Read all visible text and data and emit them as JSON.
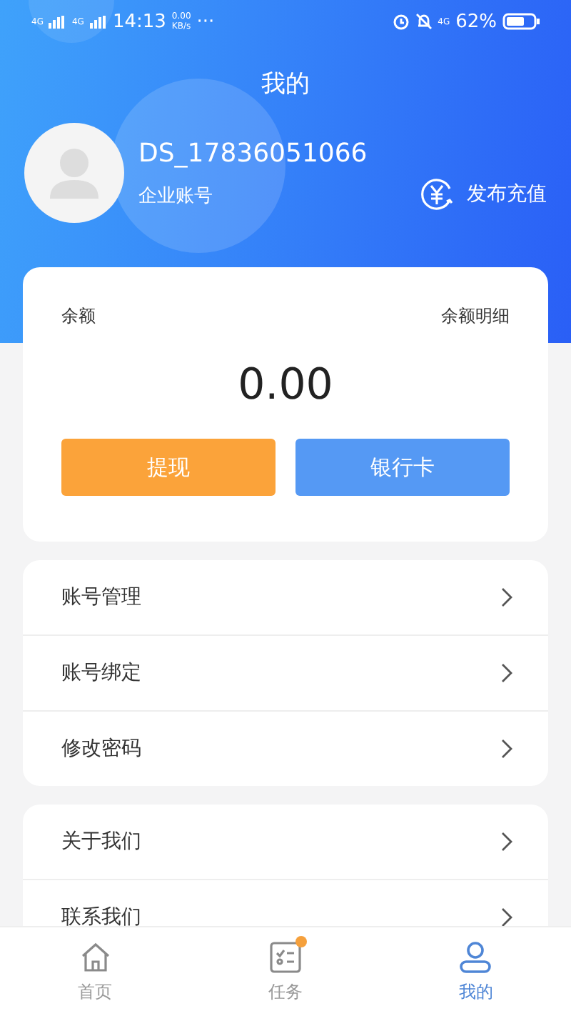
{
  "status_bar": {
    "network_1": "4G",
    "network_2": "4G",
    "time": "14:13",
    "speed_value": "0.00",
    "speed_unit": "KB/s",
    "more": "···",
    "mobile_data": "4G",
    "battery": "62%"
  },
  "header": {
    "title": "我的",
    "username": "DS_17836051066",
    "account_type": "企业账号",
    "recharge_label": "发布充值"
  },
  "balance_card": {
    "label": "余额",
    "details_link": "余额明细",
    "amount": "0.00",
    "buttons": [
      {
        "label": "提现",
        "kind": "primary"
      },
      {
        "label": "银行卡",
        "kind": "secondary"
      }
    ]
  },
  "menu_groups": [
    {
      "items": [
        "账号管理",
        "账号绑定",
        "修改密码"
      ]
    },
    {
      "items": [
        "关于我们",
        "联系我们"
      ]
    }
  ],
  "tab_bar": [
    {
      "label": "首页",
      "kind": "home",
      "selected": false,
      "badge": false
    },
    {
      "label": "任务",
      "kind": "tasks",
      "selected": false,
      "badge": true
    },
    {
      "label": "我的",
      "kind": "profile",
      "selected": true,
      "badge": false
    }
  ]
}
